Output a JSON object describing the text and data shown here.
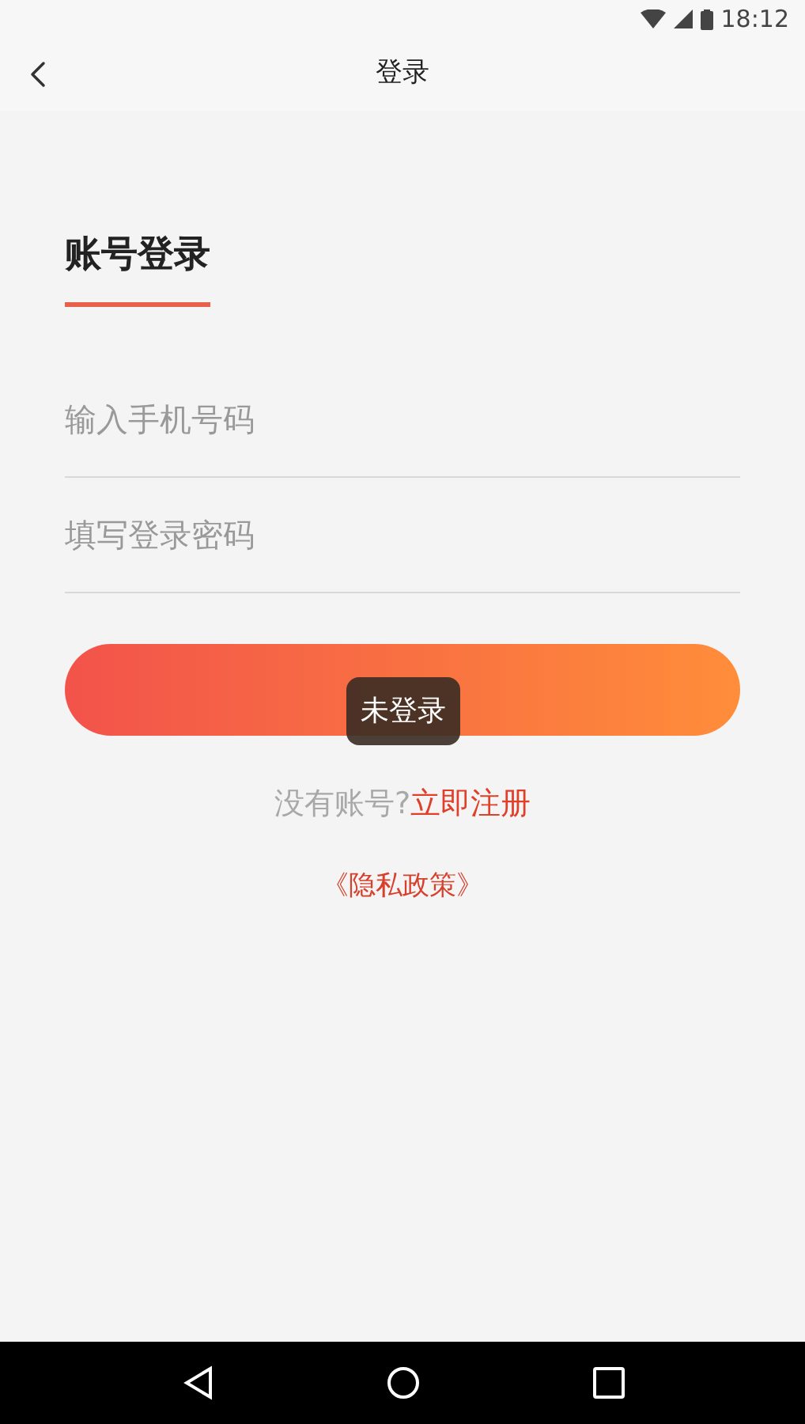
{
  "status_bar": {
    "time": "18:12"
  },
  "app_bar": {
    "title": "登录"
  },
  "login_tab": {
    "label": "账号登录",
    "selected": true
  },
  "fields": [
    {
      "placeholder": "输入手机号码"
    },
    {
      "placeholder": "填写登录密码"
    }
  ],
  "toast": {
    "text": "未登录"
  },
  "register": {
    "prompt": "没有账号?",
    "link": "立即注册"
  },
  "privacy_link": "《隐私政策》"
}
